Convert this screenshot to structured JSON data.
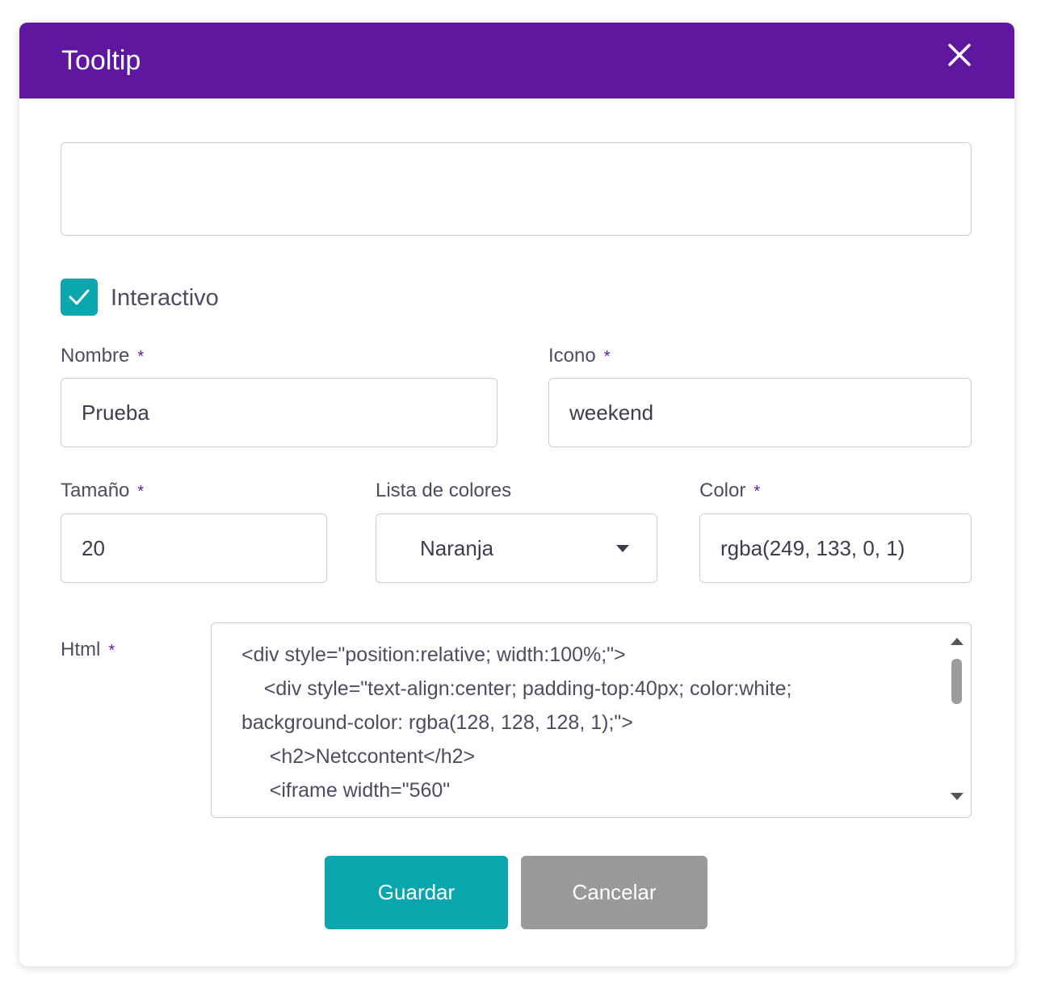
{
  "dialog": {
    "title": "Tooltip",
    "close_icon": "close-icon",
    "header_color": "#5f17a0"
  },
  "description": {
    "value": ""
  },
  "interactive": {
    "label": "Interactivo",
    "checked": true,
    "color": "#0aa6ad"
  },
  "fields": {
    "nombre": {
      "label": "Nombre",
      "required": "*",
      "value": "Prueba"
    },
    "icono": {
      "label": "Icono",
      "required": "*",
      "value": "weekend"
    },
    "tamano": {
      "label": "Tamaño",
      "required": "*",
      "value": "20"
    },
    "lista_colores": {
      "label": "Lista de colores",
      "selected": "Naranja"
    },
    "color": {
      "label": "Color",
      "required": "*",
      "value": "rgba(249, 133, 0, 1)"
    },
    "html": {
      "label": "Html",
      "required": "*",
      "lines": [
        "<div style=\"position:relative; width:100%;\">",
        "    <div style=\"text-align:center; padding-top:40px; color:white;",
        "background-color: rgba(128, 128, 128, 1);\">",
        "     <h2>Netccontent</h2>",
        "     <iframe width=\"560\""
      ]
    }
  },
  "buttons": {
    "save": "Guardar",
    "cancel": "Cancelar",
    "save_color": "#0aa6ad",
    "cancel_color": "#999999"
  }
}
